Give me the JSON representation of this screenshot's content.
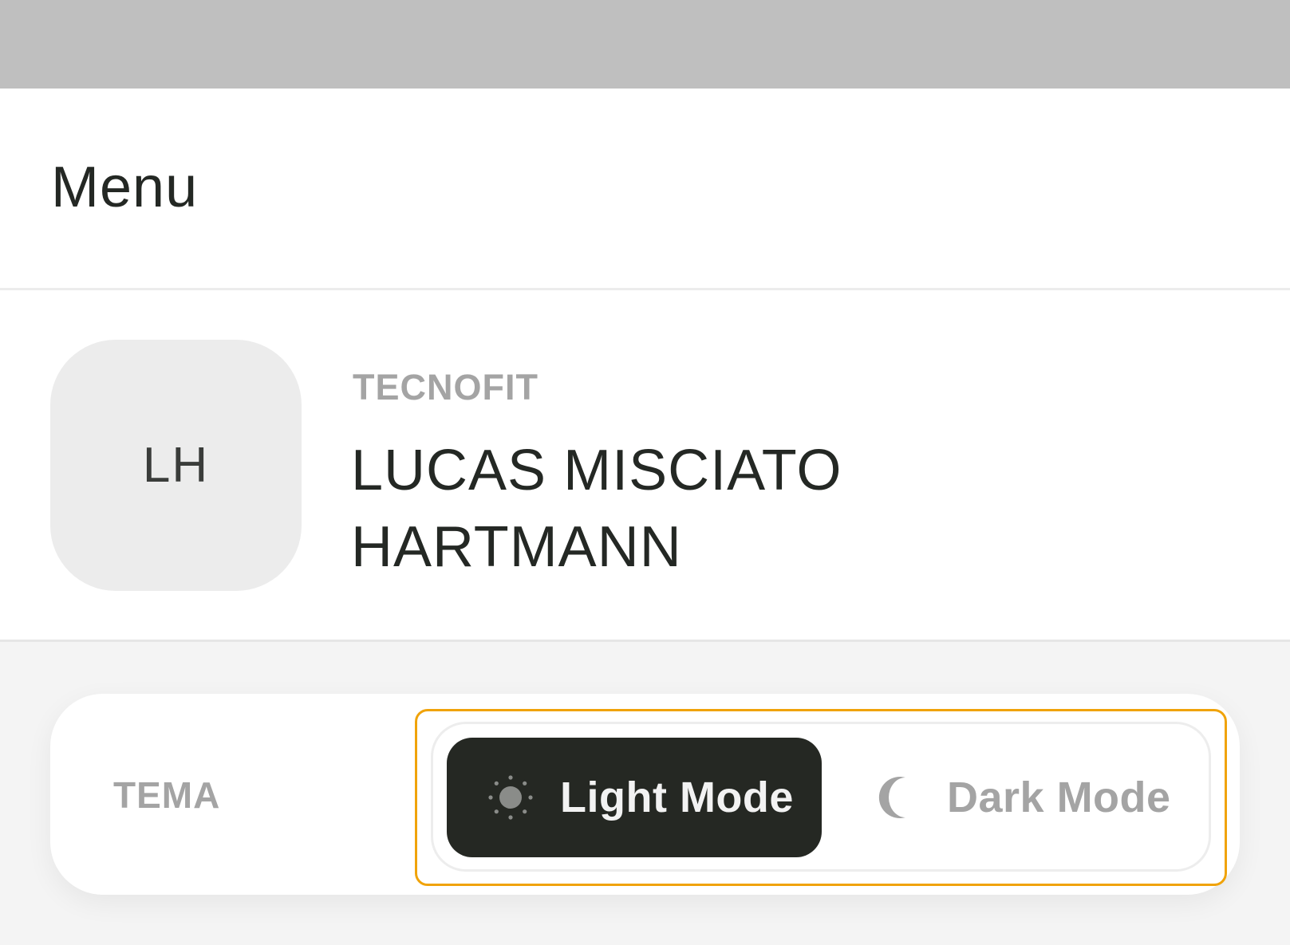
{
  "header": {
    "title": "Menu"
  },
  "profile": {
    "initials": "LH",
    "organization": "TECNOFIT",
    "name": "LUCAS MISCIATO HARTMANN"
  },
  "theme": {
    "label": "TEMA",
    "options": [
      {
        "label": "Light Mode",
        "icon": "sun-icon",
        "selected": true
      },
      {
        "label": "Dark Mode",
        "icon": "moon-icon",
        "selected": false
      }
    ]
  },
  "colors": {
    "top_bar": "#bfbfbf",
    "text_primary": "#242824",
    "text_muted": "#a4a4a4",
    "selected_option_bg": "#252823",
    "focus_ring": "#f0a30a"
  }
}
